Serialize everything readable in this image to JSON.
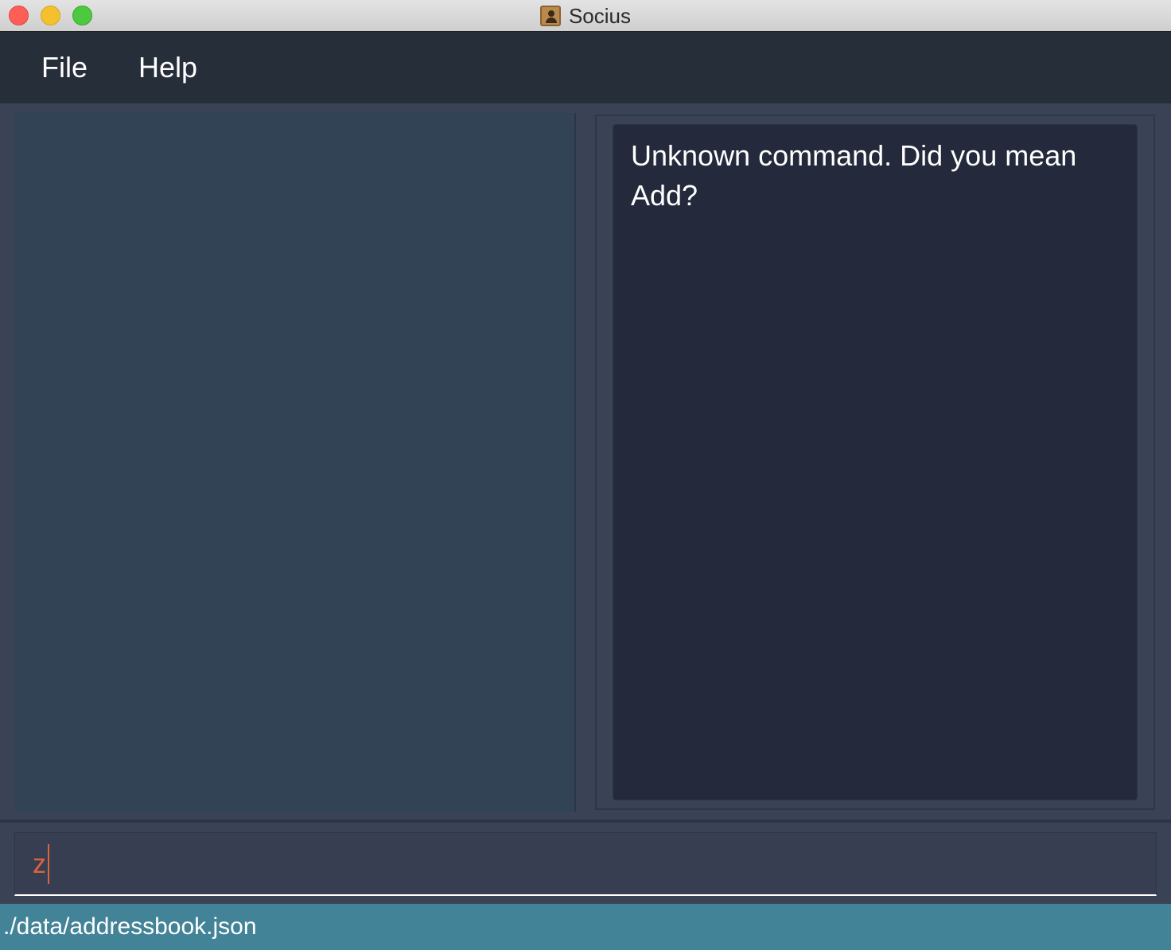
{
  "window": {
    "title": "Socius",
    "icon": "contacts-book-icon"
  },
  "menu": {
    "items": [
      {
        "label": "File"
      },
      {
        "label": "Help"
      }
    ]
  },
  "result": {
    "message": "Unknown command. Did you mean Add?"
  },
  "command": {
    "value": "z"
  },
  "status": {
    "save_location": "./data/addressbook.json"
  },
  "colors": {
    "menubar": "#262e3a",
    "background": "#3a4356",
    "list_panel": "#334356",
    "result_box": "#242a3b",
    "command_text": "#d9643f",
    "statusbar": "#428397"
  }
}
